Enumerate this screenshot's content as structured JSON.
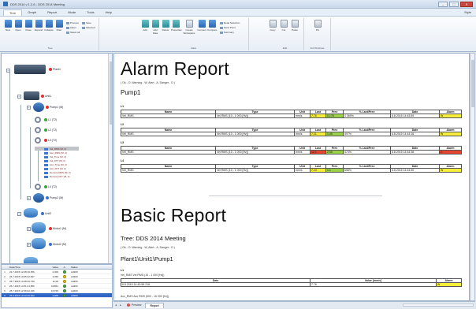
{
  "window": {
    "title": "DDS 2014 v 1.2.6 - DDS 2014 Meeting"
  },
  "menu": {
    "tabs": [
      "Tree",
      "Graph",
      "Report",
      "Mode",
      "Tools",
      "Help"
    ],
    "active": "Tree",
    "style_label": "Style"
  },
  "ribbon": {
    "groups": [
      {
        "label": "Tree",
        "buttons": [
          "New",
          "Open",
          "Close",
          "Expand",
          "Collapse",
          "Filter"
        ],
        "small": [
          "Process",
          "Alarm",
          "Select all",
          "Save",
          "Selected"
        ]
      },
      {
        "label": "Data",
        "buttons": [
          "Add",
          "Add Data",
          "Delete",
          "Properties",
          "Create Workspace",
          "Connect",
          "Compare"
        ],
        "small": [
          "Read Selection",
          "Send Point",
          "Summary"
        ]
      },
      {
        "label": "Edit",
        "buttons": [
          "Copy",
          "Cut",
          "Paste"
        ],
        "small": []
      },
      {
        "label": "Full Windows",
        "buttons": [
          "Pin"
        ],
        "small": []
      }
    ]
  },
  "tree": {
    "nodes": {
      "plant": "Plant1",
      "unit1": "Unit1",
      "pump1": "Pump1 (M)",
      "l1": "L1 (T2)",
      "l2": "L2 (T2)",
      "l3": "L3 (T2)",
      "l4": "L4 (T2)",
      "pump2": "Pump2 (M)",
      "unit2": "Unit2",
      "motor1": "Motor1 (M)",
      "motor2": "Motor2 (M)"
    },
    "channels": [
      "Vel_RMS (M, 2)",
      "Acc_RMS (M, 2)",
      "Vel_Time (M, 2)",
      "Vel_FFT (M, 2)",
      "Acc_Time (M, 2)",
      "Acc_FFT (M, 2)",
      "Demod_RMS (M, 2)",
      "Demod_FFT (M, 2)"
    ]
  },
  "alarm_table": {
    "headers": [
      "",
      "Date/Time",
      "Value",
      "A.",
      "Status"
    ],
    "rows": [
      {
        "n": "1",
        "date": "22.7.2015 12:28:16.456",
        "value": "2,300",
        "status": "Ad300",
        "state": "green"
      },
      {
        "n": "2",
        "date": "26.7.2015 13:05:32.847",
        "value": "3,356",
        "status": "Ad300",
        "state": "yellow"
      },
      {
        "n": "3",
        "date": "26.7.2015 14:48:46.730",
        "value": "11,00",
        "status": "Ad300",
        "state": "yellow"
      },
      {
        "n": "4",
        "date": "26.7.2015 14:51:21.856",
        "value": "0,8661",
        "status": "Ad300",
        "state": "green"
      },
      {
        "n": "5",
        "date": "26.7.2015 12:36:02.446",
        "value": "0,6745",
        "status": "Ad300",
        "state": "green"
      },
      {
        "n": "6",
        "date": "25.6.2015 10:10:46.002",
        "value": "2,005",
        "status": "Ad300",
        "state": "green"
      }
    ]
  },
  "report": {
    "alarm_title": "Alarm Report",
    "legend": "( Ok - O, Warning - W, Alert - A, Danger - D )",
    "pump": "Pump1",
    "headers": [
      "Name",
      "Type",
      "Unit",
      "Last",
      "Prev",
      "% Last/Prev",
      "Date",
      "Alarm"
    ],
    "sections": [
      {
        "label": "L1",
        "row": {
          "name": "Vel_RMS",
          "type": "Vel RMS (10 - 1 000 [Hz])",
          "unit": "mm/s",
          "last": "7.76",
          "prev": "0.178",
          "pct": "4 369%",
          "date": "6.8.2015 14:43:59",
          "alarm": "W",
          "last_color": "yellow",
          "prev_color": "green"
        }
      },
      {
        "label": "L2",
        "row": {
          "name": "Vel_RMS",
          "type": "Vel RMS (10 - 1 000 [Hz])",
          "unit": "mm/s",
          "last": "7.21",
          "prev": "1.45",
          "pct": "497%",
          "date": "6.8.2015 14:44:16",
          "alarm": "W",
          "last_color": "yellow",
          "prev_color": "green"
        }
      },
      {
        "label": "L3",
        "row": {
          "name": "Vel_RMS",
          "type": "Vel RMS (10 - 1 000 [Hz])",
          "unit": "mm/s",
          "last": "12.1",
          "prev": "2.55",
          "pct": "474%",
          "date": "6.8.2015 14:44:36",
          "alarm": "D",
          "last_color": "red",
          "prev_color": "green"
        }
      },
      {
        "label": "L4",
        "row": {
          "name": "Vel_RMS",
          "type": "Vel RMS (10 - 1 000 [Hz])",
          "unit": "mm/s",
          "last": "7.23",
          "prev": "1.1",
          "pct": "658%",
          "date": "6.8.2015 14:44:50",
          "alarm": "W",
          "last_color": "yellow",
          "prev_color": "green"
        }
      }
    ],
    "basic_title": "Basic Report",
    "tree_line": "Tree:   DDS 2014 Meeting",
    "path": "Plant1\\Unit1\\Pump1",
    "basic_l1": "L1",
    "basic_meas": "Vel_RMS    Vel RMS (10 - 1 000 [Hz])",
    "basic_headers": [
      "Date",
      "Value [mm/s]",
      "Alarm"
    ],
    "basic_row": {
      "date": "6.8.2015 14:43:59.216",
      "value": "7.76",
      "alarm": "W"
    },
    "basic_meas2": "Acc_RMS    Acc RMS (500 - 16 000 [Hz])"
  },
  "bottom_tabs": {
    "preview": "Preview",
    "report": "Report"
  }
}
